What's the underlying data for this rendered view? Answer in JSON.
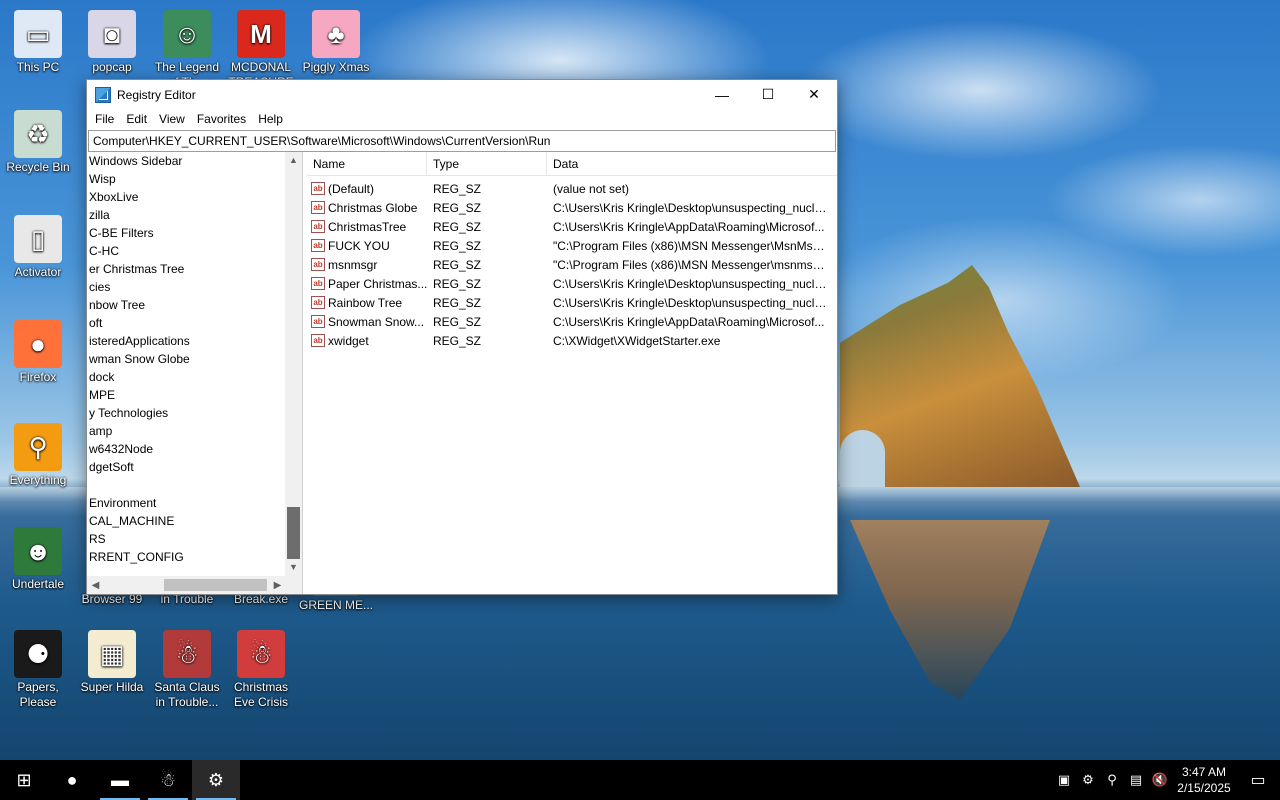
{
  "desktop": {
    "icons": [
      {
        "label": "This PC",
        "glyph": "▭",
        "color": "#dfe9f5"
      },
      {
        "label": "popcap",
        "glyph": "◙",
        "color": "#d9d6e8"
      },
      {
        "label": "The Legend of Th...",
        "glyph": "☺",
        "color": "#3c8c5c"
      },
      {
        "label": "MCDONAL TREASURE",
        "glyph": "M",
        "color": "#da291c"
      },
      {
        "label": "Piggly Xmas",
        "glyph": "♣",
        "color": "#f6a7c1"
      },
      {
        "label": "Recycle Bin",
        "glyph": "♻",
        "color": "#c9dcd2"
      },
      {
        "label": "Activator",
        "glyph": "▯",
        "color": "#e8e8e8"
      },
      {
        "label": "Firefox",
        "glyph": "●",
        "color": "#ff7139"
      },
      {
        "label": "Everything",
        "glyph": "⚲",
        "color": "#f39c12"
      },
      {
        "label": "Undertale",
        "glyph": "☻",
        "color": "#2d7a3a"
      },
      {
        "label": "Browser 99",
        "glyph": "",
        "color": ""
      },
      {
        "label": "in Trouble",
        "glyph": "",
        "color": ""
      },
      {
        "label": "Break.exe",
        "glyph": "",
        "color": ""
      },
      {
        "label": "GREEN ME...",
        "glyph": "♣",
        "color": "#2e8b57"
      },
      {
        "label": "Papers, Please",
        "glyph": "⚈",
        "color": "#1a1a1a"
      },
      {
        "label": "Super Hilda",
        "glyph": "▦",
        "color": "#f3ecd0"
      },
      {
        "label": "Santa Claus in Trouble...",
        "glyph": "☃",
        "color": "#b33a3a"
      },
      {
        "label": "Christmas Eve Crisis",
        "glyph": "☃",
        "color": "#d13c3c"
      }
    ]
  },
  "window": {
    "title": "Registry Editor",
    "controls": {
      "minimize": "—",
      "maximize": "☐",
      "close": "✕"
    },
    "menu": [
      "File",
      "Edit",
      "View",
      "Favorites",
      "Help"
    ],
    "address": "Computer\\HKEY_CURRENT_USER\\Software\\Microsoft\\Windows\\CurrentVersion\\Run",
    "tree": [
      "Windows Sidebar",
      "Wisp",
      "XboxLive",
      "zilla",
      "C-BE Filters",
      "C-HC",
      "er Christmas Tree",
      "cies",
      "nbow Tree",
      "oft",
      "isteredApplications",
      "wman Snow Globe",
      "dock",
      "MPE",
      "y Technologies",
      "amp",
      "w6432Node",
      "dgetSoft",
      "",
      "Environment",
      "CAL_MACHINE",
      "RS",
      "RRENT_CONFIG"
    ],
    "list": {
      "headers": {
        "name": "Name",
        "type": "Type",
        "data": "Data"
      },
      "rows": [
        {
          "name": "(Default)",
          "type": "REG_SZ",
          "data": "(value not set)"
        },
        {
          "name": "Christmas Globe",
          "type": "REG_SZ",
          "data": "C:\\Users\\Kris Kringle\\Desktop\\unsuspecting_nucle..."
        },
        {
          "name": "ChristmasTree",
          "type": "REG_SZ",
          "data": "C:\\Users\\Kris Kringle\\AppData\\Roaming\\Microsof..."
        },
        {
          "name": "FUCK YOU",
          "type": "REG_SZ",
          "data": "\"C:\\Program Files (x86)\\MSN Messenger\\MsnMsgr..."
        },
        {
          "name": "msnmsgr",
          "type": "REG_SZ",
          "data": "\"C:\\Program Files (x86)\\MSN Messenger\\msnmsgr..."
        },
        {
          "name": "Paper Christmas...",
          "type": "REG_SZ",
          "data": "C:\\Users\\Kris Kringle\\Desktop\\unsuspecting_nucle..."
        },
        {
          "name": "Rainbow Tree",
          "type": "REG_SZ",
          "data": "C:\\Users\\Kris Kringle\\Desktop\\unsuspecting_nucle..."
        },
        {
          "name": "Snowman Snow...",
          "type": "REG_SZ",
          "data": "C:\\Users\\Kris Kringle\\AppData\\Roaming\\Microsof..."
        },
        {
          "name": "xwidget",
          "type": "REG_SZ",
          "data": "C:\\XWidget\\XWidgetStarter.exe"
        }
      ],
      "value_icon_text": "ab"
    }
  },
  "taskbar": {
    "apps": [
      {
        "name": "start",
        "glyph": "⊞"
      },
      {
        "name": "firefox",
        "glyph": "●"
      },
      {
        "name": "file-explorer",
        "glyph": "▬"
      },
      {
        "name": "santa-game",
        "glyph": "☃"
      },
      {
        "name": "registry-editor",
        "glyph": "⚙"
      }
    ],
    "tray": [
      "▣",
      "⚙",
      "⚲",
      "▤",
      "🔇"
    ],
    "time": "3:47 AM",
    "date": "2/15/2025",
    "notifications_glyph": "▭"
  }
}
